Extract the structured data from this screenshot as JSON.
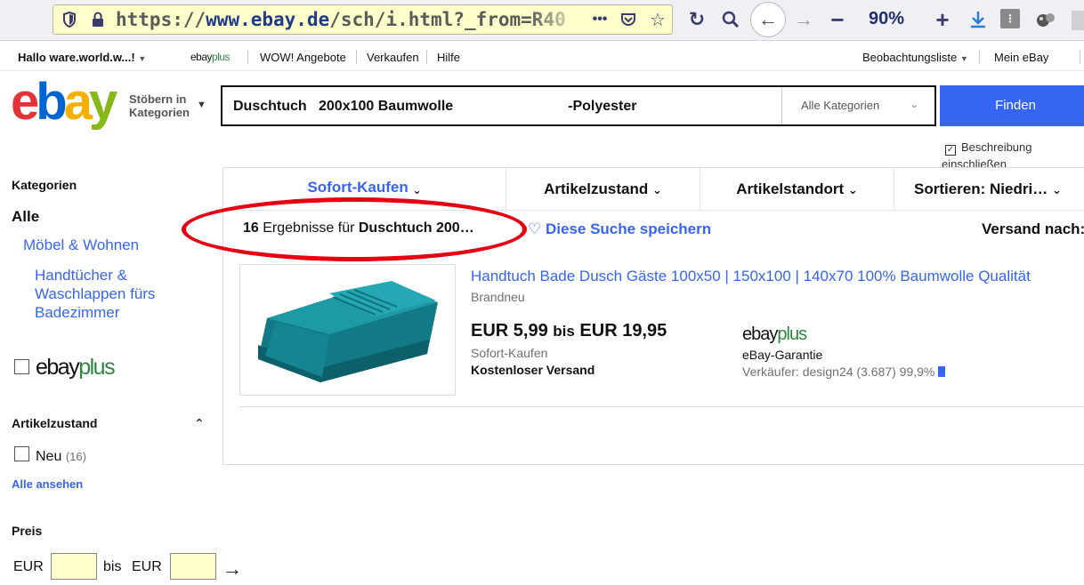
{
  "browser": {
    "url_prefix": "https://",
    "url_host": "www.ebay.de",
    "url_path": "/sch/i.html?_from=R40",
    "page_actions": "•••",
    "zoom": "90%",
    "icons": [
      "shield-icon",
      "lock-icon",
      "pocket-icon",
      "bookmark-star-icon",
      "reload-icon",
      "search-icon",
      "back-icon",
      "forward-icon",
      "zoom-out-icon",
      "zoom-in-icon",
      "download-icon",
      "extension-icon",
      "extension-balls-icon"
    ]
  },
  "top_nav": {
    "greeting": "Hallo ware.world.w...!",
    "ebayplus_ebay": "ebay",
    "ebayplus_plus": "plus",
    "links": [
      "WOW! Angebote",
      "Verkaufen",
      "Hilfe"
    ],
    "watchlist": "Beobachtungsliste",
    "my_ebay": "Mein eBay"
  },
  "header": {
    "logo": {
      "e": "e",
      "b": "b",
      "a": "a",
      "y": "y"
    },
    "shop_by_1": "Stöbern in",
    "shop_by_2": "Kategorien",
    "search_value": "Duschtuch   200x100 Baumwolle                             -Polyester",
    "category_select": "Alle Kategorien",
    "find_button": "Finden",
    "include_desc_1": "Beschreibung",
    "include_desc_2": "einschließen"
  },
  "sidebar": {
    "categories_heading": "Kategorien",
    "all": "Alle",
    "cat_1": "Möbel & Wohnen",
    "cat_2_lines": [
      "Handtücher &",
      "Waschlappen fürs",
      "Badezimmer"
    ],
    "ebayplus_ebay": "ebay",
    "ebayplus_plus": "plus",
    "condition_heading": "Artikelzustand",
    "condition_new": "Neu",
    "condition_new_count": "(16)",
    "see_all": "Alle ansehen",
    "price_heading": "Preis",
    "price_currency_from": "EUR",
    "price_to": "bis",
    "price_currency_to": "EUR"
  },
  "results": {
    "filters": [
      "Sofort-Kaufen",
      "Artikelzustand",
      "Artikelstandort",
      "Sortieren: Niedri…"
    ],
    "count": "16",
    "count_text": "Ergebnisse für",
    "count_query": "Duschtuch 200…",
    "save_search": "Diese Suche speichern",
    "ship_to": "Versand nach:",
    "item": {
      "title": "Handtuch Bade Dusch Gäste 100x50 | 150x100 | 140x70 100% Baumwolle Qualität",
      "condition": "Brandneu",
      "price_from": "EUR 5,99",
      "price_sep": "bis",
      "price_to": "EUR 19,95",
      "buy_format": "Sofort-Kaufen",
      "shipping": "Kostenloser Versand",
      "ebayplus_ebay": "ebay",
      "ebayplus_plus": "plus",
      "guarantee": "eBay-Garantie",
      "seller": "Verkäufer: design24 (3.687) 99,9%"
    }
  },
  "colors": {
    "ebay_red": "#e53238",
    "ebay_blue": "#0064d2",
    "ebay_yellow": "#f5af02",
    "ebay_green": "#86b817",
    "link_blue": "#3665f3",
    "annotation_red": "#e60012",
    "url_bar_bg": "#ffffcc"
  }
}
